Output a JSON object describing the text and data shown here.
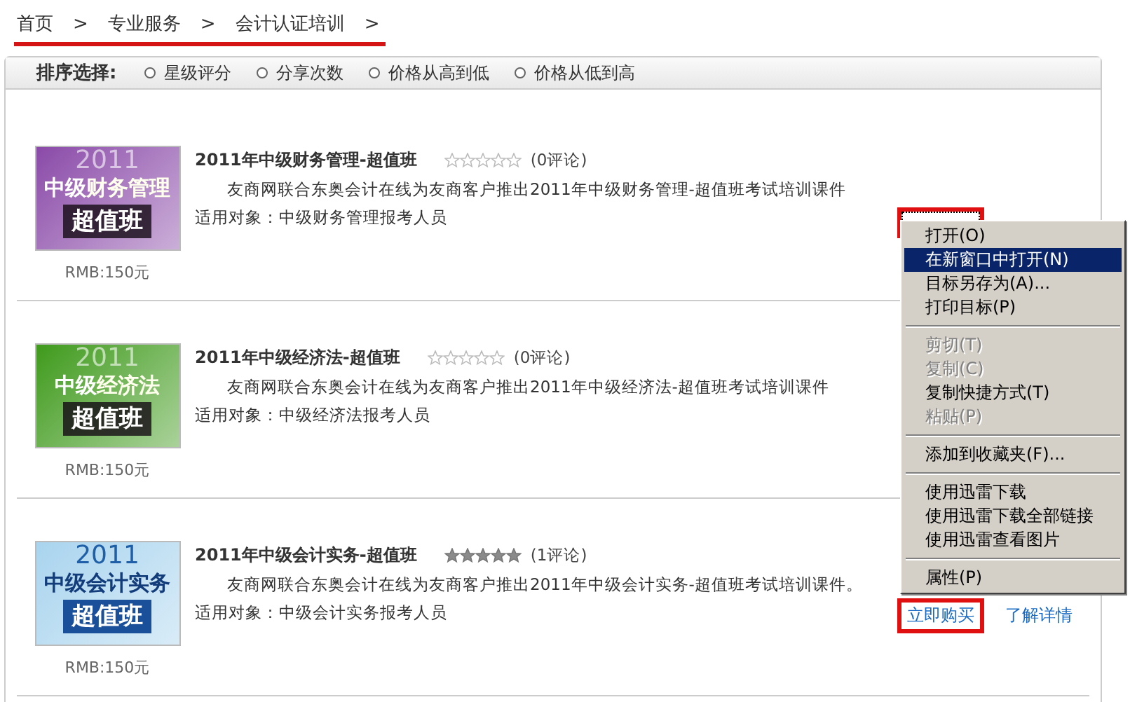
{
  "breadcrumb": {
    "items": [
      "首页",
      "专业服务",
      "会计认证培训"
    ],
    "separator": ">",
    "annotated": true
  },
  "sort_bar": {
    "label": "排序选择:",
    "options": [
      {
        "label": "星级评分",
        "selected": false
      },
      {
        "label": "分享次数",
        "selected": false
      },
      {
        "label": "价格从高到低",
        "selected": false
      },
      {
        "label": "价格从低到高",
        "selected": false
      }
    ]
  },
  "products": [
    {
      "banner": {
        "year": "2011",
        "level": "中级",
        "subject": "财务管理",
        "badge": "超值班",
        "color": "#8a4aa8"
      },
      "title": "2011年中级财务管理-超值班",
      "stars": 0,
      "reviews": "(0评论)",
      "description": "友商网联合东奥会计在线为友商客户推出2011年中级财务管理-超值班考试培训课件",
      "audience": "适用对象：中级财务管理报考人员",
      "price": "RMB:150元",
      "actions": [
        {
          "annotated": true,
          "focused": true
        }
      ]
    },
    {
      "banner": {
        "year": "2011",
        "level": "中级",
        "subject": "经济法",
        "badge": "超值班",
        "color": "#3f9a1c"
      },
      "title": "2011年中级经济法-超值班",
      "stars": 0,
      "reviews": "(0评论)",
      "description": "友商网联合东奥会计在线为友商客户推出2011年中级经济法-超值班考试培训课件",
      "audience": "适用对象：中级经济法报考人员",
      "price": "RMB:150元"
    },
    {
      "banner": {
        "year": "2011",
        "level": "中级",
        "subject": "会计实务",
        "badge": "超值班",
        "color": "#a9d4ee"
      },
      "title": "2011年中级会计实务-超值班",
      "stars": 5,
      "reviews": "(1评论)",
      "description": "友商网联合东奥会计在线为友商客户推出2011年中级会计实务-超值班考试培训课件。",
      "audience": "适用对象：中级会计实务报考人员",
      "price": "RMB:150元",
      "actions": [
        {
          "label": "立即购买",
          "annotated": true,
          "focused": false
        },
        {
          "label": "了解详情",
          "annotated": false,
          "focused": false
        }
      ]
    }
  ],
  "context_menu": {
    "items": [
      {
        "kind": "item",
        "label": "打开(O)",
        "disabled": false,
        "selected": false
      },
      {
        "kind": "item",
        "label": "在新窗口中打开(N)",
        "disabled": false,
        "selected": true
      },
      {
        "kind": "item",
        "label": "目标另存为(A)...",
        "disabled": false,
        "selected": false
      },
      {
        "kind": "item",
        "label": "打印目标(P)",
        "disabled": false,
        "selected": false
      },
      {
        "kind": "separator"
      },
      {
        "kind": "item",
        "label": "剪切(T)",
        "disabled": true,
        "selected": false
      },
      {
        "kind": "item",
        "label": "复制(C)",
        "disabled": true,
        "selected": false
      },
      {
        "kind": "item",
        "label": "复制快捷方式(T)",
        "disabled": false,
        "selected": false
      },
      {
        "kind": "item",
        "label": "粘贴(P)",
        "disabled": true,
        "selected": false
      },
      {
        "kind": "separator"
      },
      {
        "kind": "item",
        "label": "添加到收藏夹(F)...",
        "disabled": false,
        "selected": false
      },
      {
        "kind": "separator"
      },
      {
        "kind": "item",
        "label": "使用迅雷下载",
        "disabled": false,
        "selected": false
      },
      {
        "kind": "item",
        "label": "使用迅雷下载全部链接",
        "disabled": false,
        "selected": false
      },
      {
        "kind": "item",
        "label": "使用迅雷查看图片",
        "disabled": false,
        "selected": false
      },
      {
        "kind": "separator"
      },
      {
        "kind": "item",
        "label": "属性(P)",
        "disabled": false,
        "selected": false
      }
    ]
  }
}
